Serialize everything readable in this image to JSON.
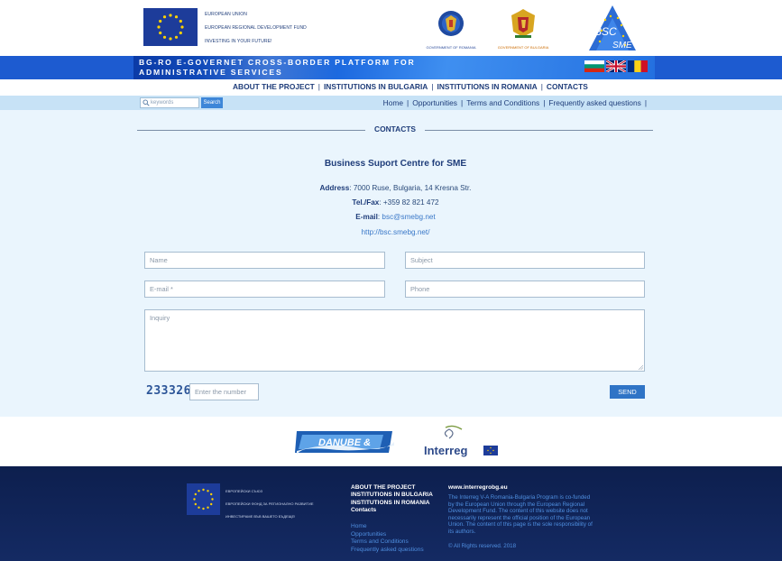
{
  "header": {
    "eu_lines": [
      "EUROPEAN UNION",
      "EUROPEAN REGIONAL DEVELOPMENT FUND",
      "INVESTING IN YOUR FUTURE!"
    ],
    "gov_ro_label": "GOVERNMENT OF ROMANIA",
    "gov_bg_label": "GOVERNMENT OF BULGARIA",
    "bsc_logo_text": [
      "BSC",
      "SME"
    ],
    "banner_line1": "BG-RO E-GOVERNET CROSS-BORDER PLATFORM FOR",
    "banner_line2": "ADMINISTRATIVE SERVICES",
    "languages": [
      "bulgarian-flag-icon",
      "uk-flag-icon",
      "romanian-flag-icon"
    ]
  },
  "main_nav": [
    "ABOUT THE PROJECT",
    "INSTITUTIONS IN BULGARIA",
    "INSTITUTIONS IN ROMANIA",
    "CONTACTS"
  ],
  "search": {
    "placeholder": "keywords",
    "button_label": "Search"
  },
  "sub_nav": [
    "Home",
    "Opportunities",
    "Terms and Conditions",
    "Frequently asked questions"
  ],
  "section": {
    "title": "CONTACTS"
  },
  "contact": {
    "org_name": "Business Suport Centre for SME",
    "address_label": "Address",
    "address_value": ": 7000 Ruse, Bulgaria, 14 Kresna Str.",
    "tel_label": "Tel./Fax",
    "tel_value": ": +359 82 821 472",
    "email_label": "E-mail",
    "email_sep": ": ",
    "email_value": "bsc@smebg.net",
    "website": "http://bsc.smebg.net/"
  },
  "form": {
    "name_placeholder": "Name",
    "subject_placeholder": "Subject",
    "email_placeholder": "E-mail *",
    "phone_placeholder": "Phone",
    "inquiry_placeholder": "Inquiry",
    "captcha_code": "233326",
    "captcha_placeholder": "Enter the number",
    "send_label": "SEND"
  },
  "partners": {
    "danube_text": "DANUBE &",
    "interreg_text": "Interreg"
  },
  "footer": {
    "eu_lines": [
      "ЕВРОПЕЙСКИ СЪЮЗ",
      "ЕВРОПЕЙСКИ ФОНД ЗА РЕГИОНАЛНО РАЗВИТИЕ",
      "ИНВЕСТИРАМЕ ВЪВ ВАШЕТО БЪДЕЩЕ!"
    ],
    "nav_bold": [
      "ABOUT THE PROJECT",
      "INSTITUTIONS IN BULGARIA",
      "INSTITUTIONS IN ROMANIA",
      "Contacts"
    ],
    "nav_links": [
      "Home",
      "Opportunities",
      "Terms and Conditions",
      "Frequently asked questions"
    ],
    "site": "www.interregrobg.eu",
    "text": "The Interreg V-A Romania-Bulgaria Program is co-funded by the European Union through the European Regional Development Fund. The content of this website does not necessarily represent the official position of the European Union. The content of this page is the sole responsibility of its authors.",
    "copyright": "© All Rights reserved. 2018"
  },
  "colors": {
    "brand_blue": "#1f3d7a",
    "banner_blue": "#1d5bd0",
    "subnav_bg": "#c7e2f6",
    "content_bg": "#eaf5fd",
    "button_blue": "#2f74c6",
    "footer_bg": "#0d1f4e"
  }
}
